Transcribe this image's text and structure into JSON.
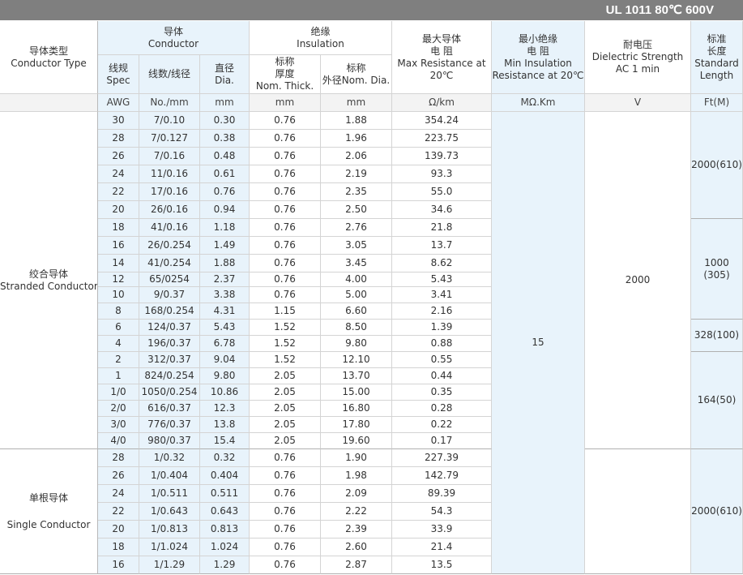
{
  "title": "UL 1011 80℃ 600V",
  "headers": {
    "conductor_type_cn": "导体类型",
    "conductor_type_en": "Conductor Type",
    "conductor_cn": "导体",
    "conductor_en": "Conductor",
    "spec_cn": "线规",
    "spec_en": "Spec",
    "strands": "线数/线径",
    "dia_cn": "直径",
    "dia_en": "Dia.",
    "insulation_cn": "绝缘",
    "insulation_en": "Insulation",
    "nom_thick_cn1": "标称",
    "nom_thick_cn2": "厚度",
    "nom_thick_en": "Nom. Thick.",
    "nom_dia_cn": "标称",
    "nom_dia_en": "外径Nom. Dia.",
    "max_res_cn1": "最大导体",
    "max_res_cn2": "电  阻",
    "max_res_en1": "Max Resistance at",
    "max_res_en2": "20℃",
    "min_ins_cn1": "最小绝缘",
    "min_ins_cn2": "电  阻",
    "min_ins_en1": "Min Insulation",
    "min_ins_en2": "Resistance at 20℃",
    "dielectric_cn": "耐电压",
    "dielectric_en1": "Dielectric Strength",
    "dielectric_en2": "AC 1 min",
    "length_cn1": "标准",
    "length_cn2": "长度",
    "length_en1": "Standard",
    "length_en2": "Length"
  },
  "units": [
    "AWG",
    "No./mm",
    "mm",
    "mm",
    "mm",
    "Ω/km",
    "MΩ.Km",
    "V",
    "Ft(M)"
  ],
  "groups": {
    "stranded": {
      "cn": "绞合导体",
      "en": "Stranded Conductor"
    },
    "single": {
      "cn": "单根导体",
      "en": "Single Conductor"
    }
  },
  "min_insulation_value": "15",
  "dielectric_value": "2000",
  "lengths": {
    "l1": "2000(610)",
    "l2a": "1000",
    "l2b": "(305)",
    "l3": "328(100)",
    "l4": "164(50)",
    "l5": "2000(610)"
  },
  "rows": [
    [
      "30",
      "7/0.10",
      "0.30",
      "0.76",
      "1.88",
      "354.24"
    ],
    [
      "28",
      "7/0.127",
      "0.38",
      "0.76",
      "1.96",
      "223.75"
    ],
    [
      "26",
      "7/0.16",
      "0.48",
      "0.76",
      "2.06",
      "139.73"
    ],
    [
      "24",
      "11/0.16",
      "0.61",
      "0.76",
      "2.19",
      "93.3"
    ],
    [
      "22",
      "17/0.16",
      "0.76",
      "0.76",
      "2.35",
      "55.0"
    ],
    [
      "20",
      "26/0.16",
      "0.94",
      "0.76",
      "2.50",
      "34.6"
    ],
    [
      "18",
      "41/0.16",
      "1.18",
      "0.76",
      "2.76",
      "21.8"
    ],
    [
      "16",
      "26/0.254",
      "1.49",
      "0.76",
      "3.05",
      "13.7"
    ],
    [
      "14",
      "41/0.254",
      "1.88",
      "0.76",
      "3.45",
      "8.62"
    ],
    [
      "12",
      "65/0254",
      "2.37",
      "0.76",
      "4.00",
      "5.43"
    ],
    [
      "10",
      "9/0.37",
      "3.38",
      "0.76",
      "5.00",
      "3.41"
    ],
    [
      "8",
      "168/0.254",
      "4.31",
      "1.15",
      "6.60",
      "2.16"
    ],
    [
      "6",
      "124/0.37",
      "5.43",
      "1.52",
      "8.50",
      "1.39"
    ],
    [
      "4",
      "196/0.37",
      "6.78",
      "1.52",
      "9.80",
      "0.88"
    ],
    [
      "2",
      "312/0.37",
      "9.04",
      "1.52",
      "12.10",
      "0.55"
    ],
    [
      "1",
      "824/0.254",
      "9.80",
      "2.05",
      "13.70",
      "0.44"
    ],
    [
      "1/0",
      "1050/0.254",
      "10.86",
      "2.05",
      "15.00",
      "0.35"
    ],
    [
      "2/0",
      "616/0.37",
      "12.3",
      "2.05",
      "16.80",
      "0.28"
    ],
    [
      "3/0",
      "776/0.37",
      "13.8",
      "2.05",
      "17.80",
      "0.22"
    ],
    [
      "4/0",
      "980/0.37",
      "15.4",
      "2.05",
      "19.60",
      "0.17"
    ],
    [
      "28",
      "1/0.32",
      "0.32",
      "0.76",
      "1.90",
      "227.39"
    ],
    [
      "26",
      "1/0.404",
      "0.404",
      "0.76",
      "1.98",
      "142.79"
    ],
    [
      "24",
      "1/0.511",
      "0.511",
      "0.76",
      "2.09",
      "89.39"
    ],
    [
      "22",
      "1/0.643",
      "0.643",
      "0.76",
      "2.22",
      "54.3"
    ],
    [
      "20",
      "1/0.813",
      "0.813",
      "0.76",
      "2.39",
      "33.9"
    ],
    [
      "18",
      "1/1.024",
      "1.024",
      "0.76",
      "2.60",
      "21.4"
    ],
    [
      "16",
      "1/1.29",
      "1.29",
      "0.76",
      "2.87",
      "13.5"
    ]
  ]
}
